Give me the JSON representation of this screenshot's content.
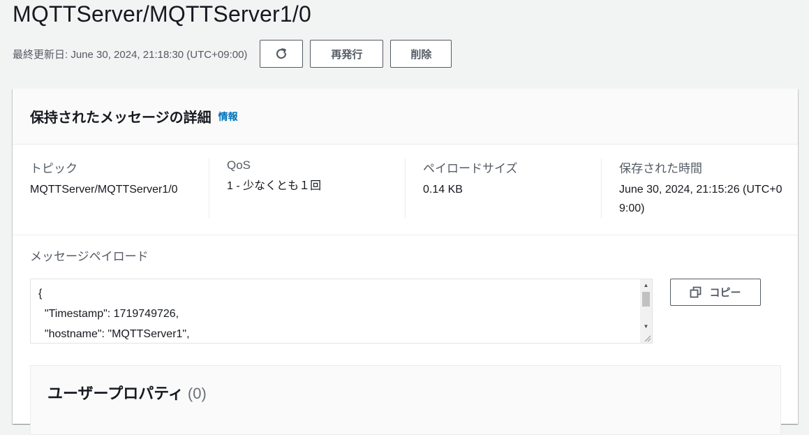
{
  "page": {
    "title": "MQTTServer/MQTTServer1/0",
    "last_updated": "最終更新日: June 30, 2024, 21:18:30 (UTC+09:00)"
  },
  "actions": {
    "refresh_icon": "refresh-icon",
    "republish_label": "再発行",
    "delete_label": "削除"
  },
  "details": {
    "title": "保持されたメッセージの詳細",
    "info_label": "情報",
    "fields": [
      {
        "label": "トピック",
        "value": "MQTTServer/MQTTServer1/0"
      },
      {
        "label": "QoS",
        "value": "1 - 少なくとも１回"
      },
      {
        "label": "ペイロードサイズ",
        "value": "0.14 KB"
      },
      {
        "label": "保存された時間",
        "value": "June 30, 2024, 21:15:26 (UTC+09:00)"
      }
    ]
  },
  "payload": {
    "label": "メッセージペイロード",
    "text": "{\n  \"Timestamp\": 1719749726,\n  \"hostname\": \"MQTTServer1\",",
    "copy_label": "コピー",
    "copy_icon": "copy-icon"
  },
  "user_properties": {
    "title": "ユーザープロパティ",
    "count": "(0)"
  }
}
